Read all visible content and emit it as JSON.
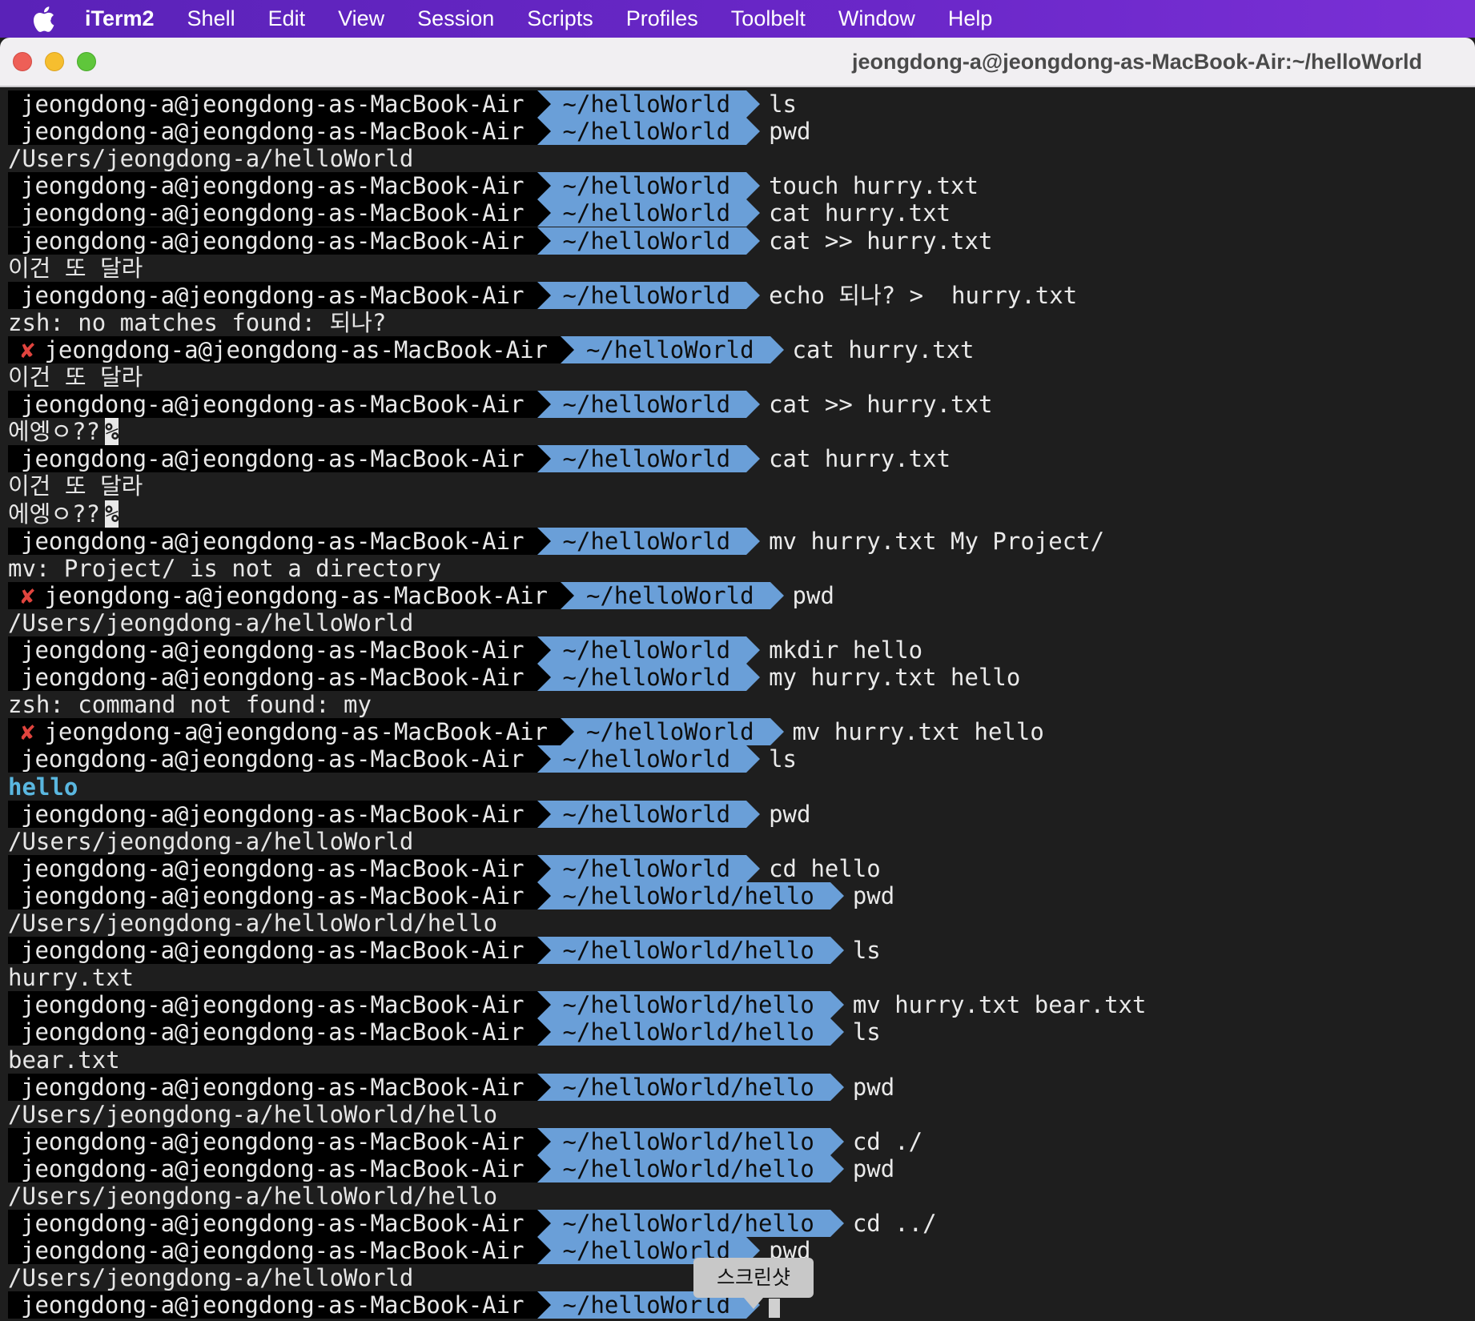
{
  "menubar": {
    "app": "iTerm2",
    "items": [
      "Shell",
      "Edit",
      "View",
      "Session",
      "Scripts",
      "Profiles",
      "Toolbelt",
      "Window",
      "Help"
    ]
  },
  "window": {
    "title": "jeongdong-a@jeongdong-as-MacBook-Air:~/helloWorld"
  },
  "prompt": {
    "user_host": "jeongdong-a@jeongdong-as-MacBook-Air",
    "error_mark": "✘",
    "colors": {
      "user_bg": "#000000",
      "dir_bg": "#6a9fd8",
      "error": "#e0443e",
      "dir_listing": "#5ab7e0"
    }
  },
  "lines": [
    {
      "type": "prompt",
      "dir": "~/helloWorld",
      "cmd": "ls"
    },
    {
      "type": "prompt",
      "dir": "~/helloWorld",
      "cmd": "pwd"
    },
    {
      "type": "output",
      "text": "/Users/jeongdong-a/helloWorld"
    },
    {
      "type": "prompt",
      "dir": "~/helloWorld",
      "cmd": "touch hurry.txt"
    },
    {
      "type": "prompt",
      "dir": "~/helloWorld",
      "cmd": "cat hurry.txt"
    },
    {
      "type": "prompt",
      "dir": "~/helloWorld",
      "cmd": "cat >> hurry.txt"
    },
    {
      "type": "output",
      "text": "이건 또 달라"
    },
    {
      "type": "prompt",
      "dir": "~/helloWorld",
      "cmd": "echo 되나? >  hurry.txt"
    },
    {
      "type": "output",
      "text": "zsh: no matches found: 되나?"
    },
    {
      "type": "prompt",
      "error": true,
      "dir": "~/helloWorld",
      "cmd": "cat hurry.txt"
    },
    {
      "type": "output",
      "text": "이건 또 달라"
    },
    {
      "type": "prompt",
      "dir": "~/helloWorld",
      "cmd": "cat >> hurry.txt"
    },
    {
      "type": "output",
      "text": "에엥ㅇ??",
      "pct": "%"
    },
    {
      "type": "prompt",
      "dir": "~/helloWorld",
      "cmd": "cat hurry.txt"
    },
    {
      "type": "output",
      "text": "이건 또 달라"
    },
    {
      "type": "output",
      "text": "에엥ㅇ??",
      "pct": "%"
    },
    {
      "type": "prompt",
      "dir": "~/helloWorld",
      "cmd": "mv hurry.txt My Project/"
    },
    {
      "type": "output",
      "text": "mv: Project/ is not a directory"
    },
    {
      "type": "prompt",
      "error": true,
      "dir": "~/helloWorld",
      "cmd": "pwd"
    },
    {
      "type": "output",
      "text": "/Users/jeongdong-a/helloWorld"
    },
    {
      "type": "prompt",
      "dir": "~/helloWorld",
      "cmd": "mkdir hello"
    },
    {
      "type": "prompt",
      "dir": "~/helloWorld",
      "cmd": "my hurry.txt hello"
    },
    {
      "type": "output",
      "text": "zsh: command not found: my"
    },
    {
      "type": "prompt",
      "error": true,
      "dir": "~/helloWorld",
      "cmd": "mv hurry.txt hello"
    },
    {
      "type": "prompt",
      "dir": "~/helloWorld",
      "cmd": "ls"
    },
    {
      "type": "output",
      "text": "hello",
      "style": "dir"
    },
    {
      "type": "prompt",
      "dir": "~/helloWorld",
      "cmd": "pwd"
    },
    {
      "type": "output",
      "text": "/Users/jeongdong-a/helloWorld"
    },
    {
      "type": "prompt",
      "dir": "~/helloWorld",
      "cmd": "cd hello"
    },
    {
      "type": "prompt",
      "dir": "~/helloWorld/hello",
      "cmd": "pwd"
    },
    {
      "type": "output",
      "text": "/Users/jeongdong-a/helloWorld/hello"
    },
    {
      "type": "prompt",
      "dir": "~/helloWorld/hello",
      "cmd": "ls"
    },
    {
      "type": "output",
      "text": "hurry.txt"
    },
    {
      "type": "prompt",
      "dir": "~/helloWorld/hello",
      "cmd": "mv hurry.txt bear.txt"
    },
    {
      "type": "prompt",
      "dir": "~/helloWorld/hello",
      "cmd": "ls"
    },
    {
      "type": "output",
      "text": "bear.txt"
    },
    {
      "type": "prompt",
      "dir": "~/helloWorld/hello",
      "cmd": "pwd"
    },
    {
      "type": "output",
      "text": "/Users/jeongdong-a/helloWorld/hello"
    },
    {
      "type": "prompt",
      "dir": "~/helloWorld/hello",
      "cmd": "cd ./"
    },
    {
      "type": "prompt",
      "dir": "~/helloWorld/hello",
      "cmd": "pwd"
    },
    {
      "type": "output",
      "text": "/Users/jeongdong-a/helloWorld/hello"
    },
    {
      "type": "prompt",
      "dir": "~/helloWorld/hello",
      "cmd": "cd ../"
    },
    {
      "type": "prompt",
      "dir": "~/helloWorld",
      "cmd": "pwd"
    },
    {
      "type": "output",
      "text": "/Users/jeongdong-a/helloWorld"
    },
    {
      "type": "prompt",
      "dir": "~/helloWorld",
      "cmd": "",
      "cursor": true
    }
  ],
  "tooltip": {
    "text": "스크린샷"
  }
}
